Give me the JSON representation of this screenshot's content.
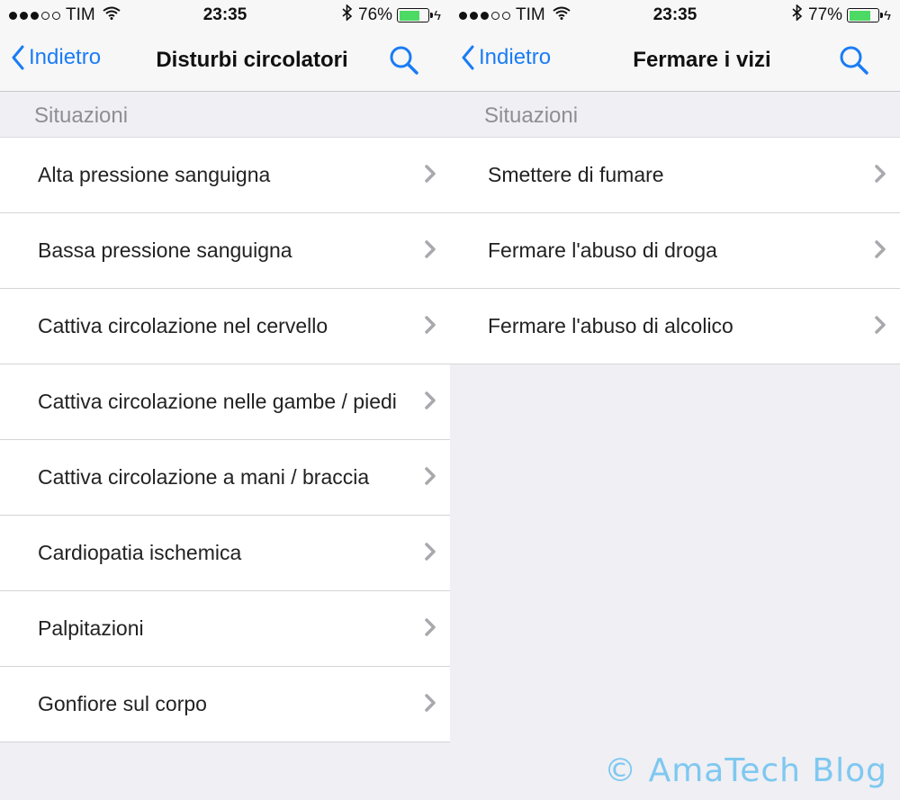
{
  "screens": [
    {
      "status": {
        "carrier": "TIM",
        "time": "23:35",
        "battery": "76%",
        "battery_level": 0.76
      },
      "nav": {
        "back_label": "Indietro",
        "title": "Disturbi circolatori"
      },
      "section_header": "Situazioni",
      "items": [
        {
          "label": "Alta pressione sanguigna"
        },
        {
          "label": "Bassa pressione sanguigna"
        },
        {
          "label": "Cattiva circolazione nel cervello"
        },
        {
          "label": "Cattiva circolazione nelle gambe / piedi"
        },
        {
          "label": "Cattiva circolazione a mani / braccia"
        },
        {
          "label": "Cardiopatia ischemica"
        },
        {
          "label": "Palpitazioni"
        },
        {
          "label": "Gonfiore sul corpo"
        }
      ]
    },
    {
      "status": {
        "carrier": "TIM",
        "time": "23:35",
        "battery": "77%",
        "battery_level": 0.77
      },
      "nav": {
        "back_label": "Indietro",
        "title": "Fermare i vizi"
      },
      "section_header": "Situazioni",
      "items": [
        {
          "label": "Smettere di fumare"
        },
        {
          "label": "Fermare l'abuso di droga"
        },
        {
          "label": "Fermare l'abuso di alcolico"
        }
      ]
    }
  ],
  "colors": {
    "accent": "#1a7cf5",
    "battery_fill": "#4cd964",
    "watermark": "#7ec8f0"
  },
  "icons": {
    "back": "chevron-left-icon",
    "search": "search-icon",
    "row": "chevron-right-icon",
    "wifi": "wifi-icon",
    "bluetooth": "bluetooth-icon",
    "battery": "battery-icon",
    "charging": "bolt-icon"
  },
  "watermark": "© AmaTech Blog"
}
